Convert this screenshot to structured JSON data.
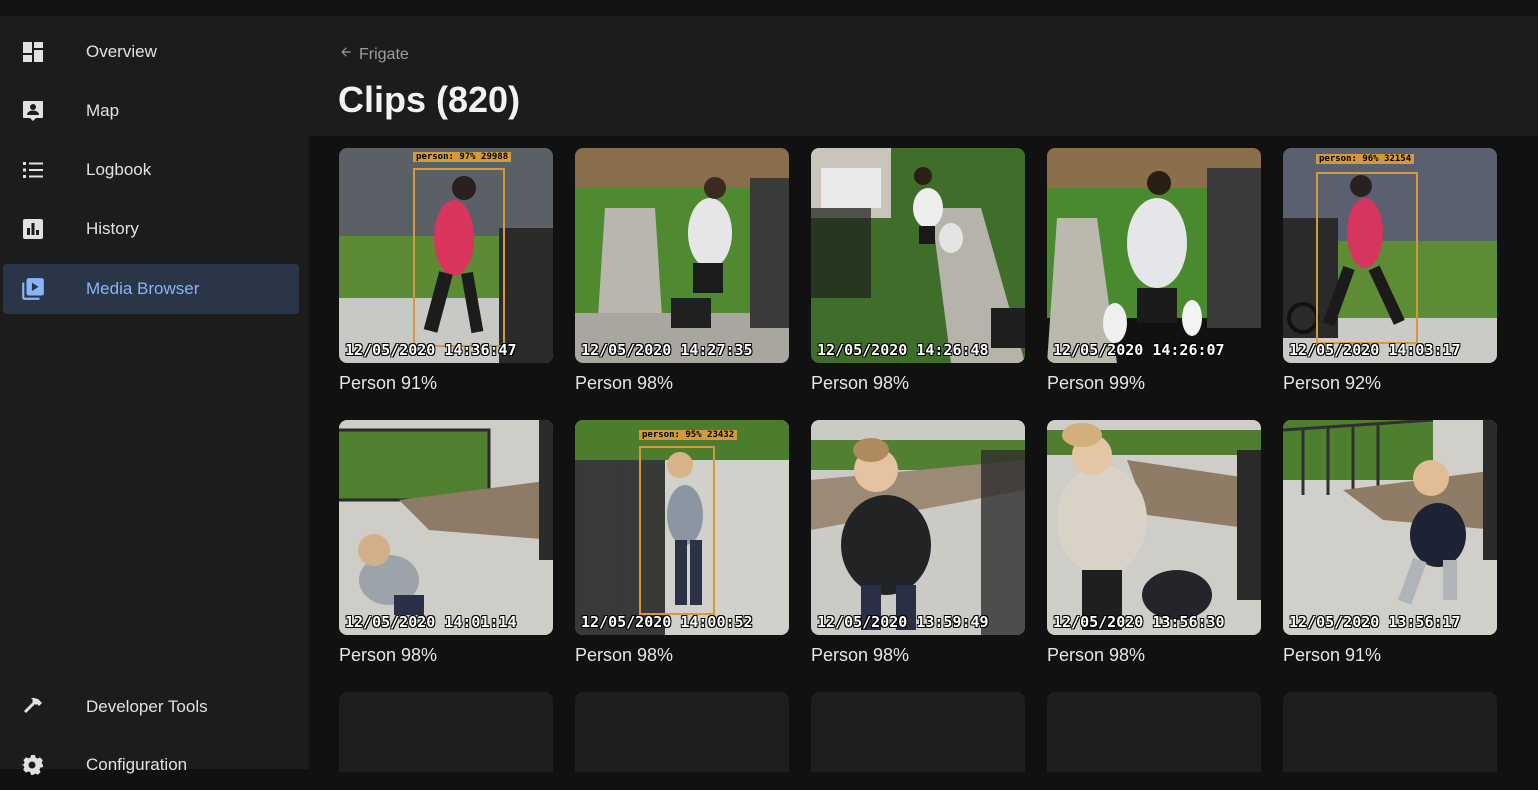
{
  "sidebar": {
    "items": [
      {
        "label": "Overview",
        "icon": "dashboard-icon"
      },
      {
        "label": "Map",
        "icon": "map-person-icon"
      },
      {
        "label": "Logbook",
        "icon": "list-icon"
      },
      {
        "label": "History",
        "icon": "chart-box-icon"
      },
      {
        "label": "Media Browser",
        "icon": "play-box-multiple-icon",
        "active": true
      }
    ],
    "bottom_items": [
      {
        "label": "Developer Tools",
        "icon": "hammer-icon"
      },
      {
        "label": "Configuration",
        "icon": "gear-icon"
      }
    ]
  },
  "header": {
    "breadcrumb": "Frigate",
    "title": "Clips (820)"
  },
  "clips": [
    {
      "timestamp": "12/05/2020 14:36:47",
      "caption": "Person 91%",
      "box_label": "person: 97% 29988"
    },
    {
      "timestamp": "12/05/2020 14:27:35",
      "caption": "Person 98%",
      "box_label": ""
    },
    {
      "timestamp": "12/05/2020 14:26:48",
      "caption": "Person 98%",
      "box_label": ""
    },
    {
      "timestamp": "12/05/2020 14:26:07",
      "caption": "Person 99%",
      "box_label": ""
    },
    {
      "timestamp": "12/05/2020 14:03:17",
      "caption": "Person 92%",
      "box_label": "person: 96% 32154"
    },
    {
      "timestamp": "12/05/2020 14:01:14",
      "caption": "Person 98%",
      "box_label": ""
    },
    {
      "timestamp": "12/05/2020 14:00:52",
      "caption": "Person 98%",
      "box_label": "person: 95% 23432"
    },
    {
      "timestamp": "12/05/2020 13:59:49",
      "caption": "Person 98%",
      "box_label": ""
    },
    {
      "timestamp": "12/05/2020 13:56:30",
      "caption": "Person 98%",
      "box_label": ""
    },
    {
      "timestamp": "12/05/2020 13:56:17",
      "caption": "Person 91%",
      "box_label": ""
    }
  ],
  "colors": {
    "accent": "#8ab4f8",
    "sidebar_bg": "#1c1c1c",
    "active_bg": "#2a3547",
    "bbox": "#d39a3a"
  }
}
